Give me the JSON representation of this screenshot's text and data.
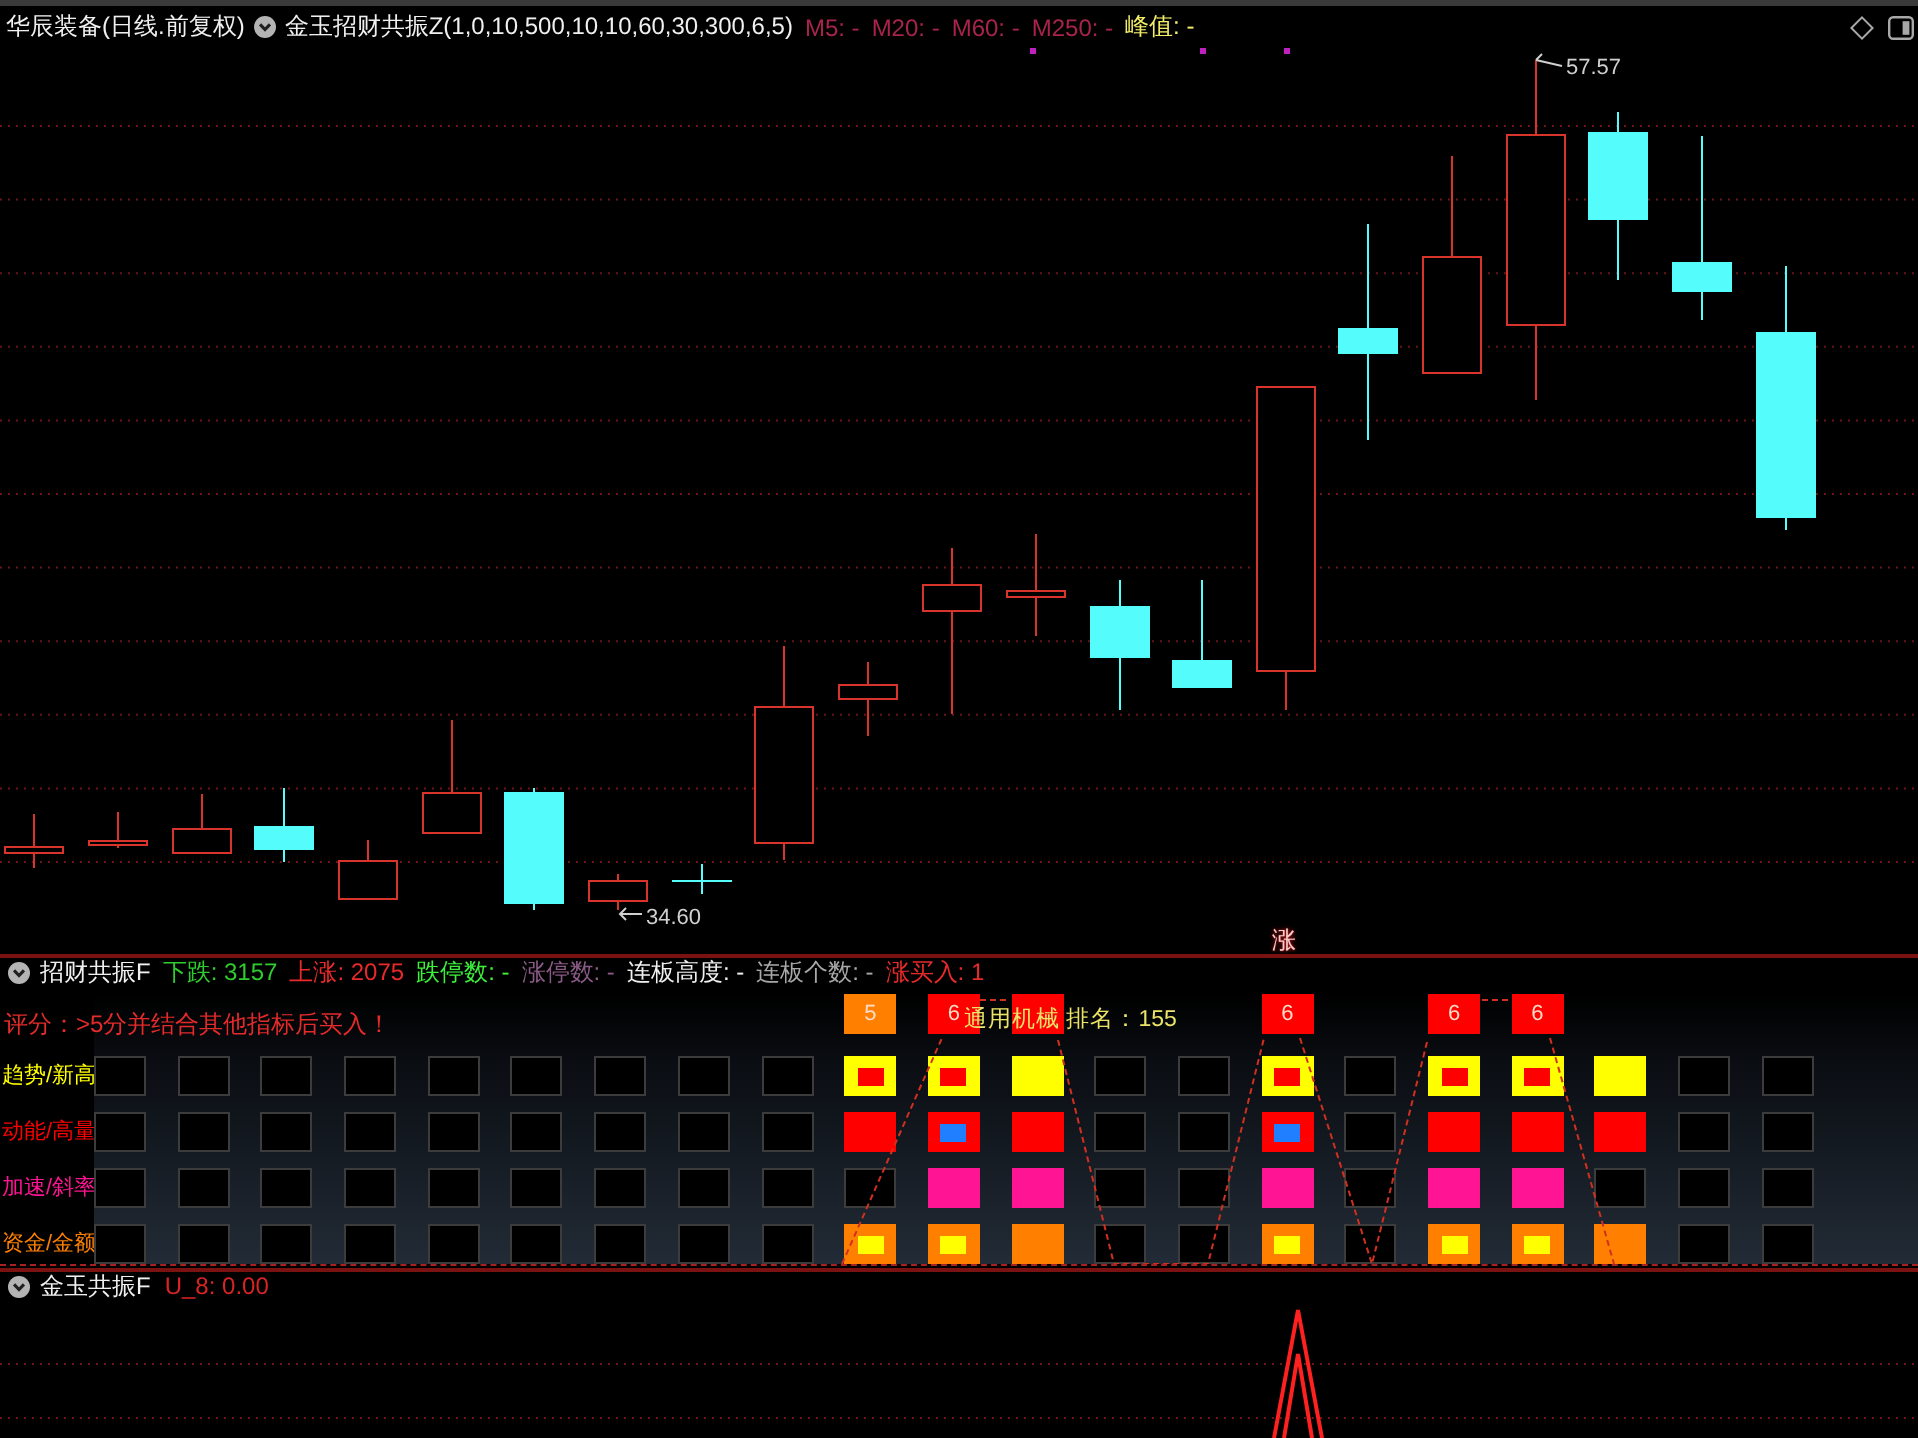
{
  "header": {
    "stock_title": "华辰装备(日线.前复权)",
    "indicator_title": "金玉招财共振Z(1,0,10,500,10,10,60,30,300,6,5)",
    "averages": [
      "M5: -",
      "M20: -",
      "M60: -",
      "M250: -"
    ],
    "peak": "峰值: -"
  },
  "price_chart": {
    "high_label": "57.57",
    "low_label": "34.60",
    "signal_label": "涨"
  },
  "signal_panel": {
    "title": "招财共振F",
    "stats": [
      {
        "text": "下跌: 3157",
        "color": "#2ecc2e"
      },
      {
        "text": "上涨: 2075",
        "color": "#e82a2a"
      },
      {
        "text": "跌停数: -",
        "color": "#3cf03c"
      },
      {
        "text": "涨停数: -",
        "color": "#8a5a86"
      },
      {
        "text": "连板高度: -",
        "color": "#f0f0f0"
      },
      {
        "text": "连板个数: -",
        "color": "#a8a8a8"
      },
      {
        "text": "涨买入: 1",
        "color": "#e82a2a"
      }
    ],
    "hint": "评分：>5分并结合其他指标后买入！",
    "industry_rank": "通用机械 排名：155",
    "scores": [
      {
        "kind": "none"
      },
      {
        "kind": "none"
      },
      {
        "kind": "none"
      },
      {
        "kind": "none"
      },
      {
        "kind": "none"
      },
      {
        "kind": "none"
      },
      {
        "kind": "none"
      },
      {
        "kind": "none"
      },
      {
        "kind": "none"
      },
      {
        "kind": "box",
        "value": "5",
        "color": "#ff8000"
      },
      {
        "kind": "box",
        "value": "6",
        "color": "#ff0000"
      },
      {
        "kind": "box",
        "color": "#ff0000"
      },
      {
        "kind": "none"
      },
      {
        "kind": "none"
      },
      {
        "kind": "box",
        "value": "6",
        "color": "#ff0000"
      },
      {
        "kind": "none"
      },
      {
        "kind": "box",
        "value": "6",
        "color": "#ff0000"
      },
      {
        "kind": "box",
        "value": "6",
        "color": "#ff0000"
      },
      {
        "kind": "none"
      },
      {
        "kind": "none"
      },
      {
        "kind": "none"
      }
    ],
    "rows": [
      {
        "label": "趋势/新高",
        "color": "#ffff00",
        "kind": "trend",
        "cells": [
          {
            "on": false,
            "marked": false
          },
          {
            "on": false,
            "marked": false
          },
          {
            "on": false,
            "marked": false
          },
          {
            "on": false,
            "marked": false
          },
          {
            "on": false,
            "marked": false
          },
          {
            "on": false,
            "marked": false
          },
          {
            "on": false,
            "marked": false
          },
          {
            "on": false,
            "marked": false
          },
          {
            "on": false,
            "marked": false
          },
          {
            "on": true,
            "marked": true
          },
          {
            "on": true,
            "marked": true
          },
          {
            "on": true,
            "marked": false
          },
          {
            "on": false,
            "marked": false
          },
          {
            "on": false,
            "marked": false
          },
          {
            "on": true,
            "marked": true
          },
          {
            "on": false,
            "marked": false
          },
          {
            "on": true,
            "marked": true
          },
          {
            "on": true,
            "marked": true
          },
          {
            "on": true,
            "marked": false
          },
          {
            "on": false,
            "marked": false
          },
          {
            "on": false,
            "marked": false
          }
        ]
      },
      {
        "label": "动能/高量",
        "color": "#ff0000",
        "kind": "momentum",
        "cells": [
          {
            "on": false,
            "marked": false
          },
          {
            "on": false,
            "marked": false
          },
          {
            "on": false,
            "marked": false
          },
          {
            "on": false,
            "marked": false
          },
          {
            "on": false,
            "marked": false
          },
          {
            "on": false,
            "marked": false
          },
          {
            "on": false,
            "marked": false
          },
          {
            "on": false,
            "marked": false
          },
          {
            "on": false,
            "marked": false
          },
          {
            "on": true,
            "marked": false
          },
          {
            "on": true,
            "marked": true
          },
          {
            "on": true,
            "marked": false
          },
          {
            "on": false,
            "marked": false
          },
          {
            "on": false,
            "marked": false
          },
          {
            "on": true,
            "marked": true
          },
          {
            "on": false,
            "marked": false
          },
          {
            "on": true,
            "marked": false
          },
          {
            "on": true,
            "marked": false
          },
          {
            "on": true,
            "marked": false
          },
          {
            "on": false,
            "marked": false
          },
          {
            "on": false,
            "marked": false
          }
        ]
      },
      {
        "label": "加速/斜率",
        "color": "#ff1493",
        "cells": [
          {
            "on": false,
            "marked": false
          },
          {
            "on": false,
            "marked": false
          },
          {
            "on": false,
            "marked": false
          },
          {
            "on": false,
            "marked": false
          },
          {
            "on": false,
            "marked": false
          },
          {
            "on": false,
            "marked": false
          },
          {
            "on": false,
            "marked": false
          },
          {
            "on": false,
            "marked": false
          },
          {
            "on": false,
            "marked": false
          },
          {
            "on": false,
            "marked": false
          },
          {
            "on": true,
            "marked": false
          },
          {
            "on": true,
            "marked": false
          },
          {
            "on": false,
            "marked": false
          },
          {
            "on": false,
            "marked": false
          },
          {
            "on": true,
            "marked": false
          },
          {
            "on": false,
            "marked": false
          },
          {
            "on": true,
            "marked": false
          },
          {
            "on": true,
            "marked": false
          },
          {
            "on": false,
            "marked": false
          },
          {
            "on": false,
            "marked": false
          },
          {
            "on": false,
            "marked": false
          }
        ]
      },
      {
        "label": "资金/金额",
        "color": "#ff8000",
        "kind": "funds",
        "cells": [
          {
            "on": false,
            "marked": false
          },
          {
            "on": false,
            "marked": false
          },
          {
            "on": false,
            "marked": false
          },
          {
            "on": false,
            "marked": false
          },
          {
            "on": false,
            "marked": false
          },
          {
            "on": false,
            "marked": false
          },
          {
            "on": false,
            "marked": false
          },
          {
            "on": false,
            "marked": false
          },
          {
            "on": false,
            "marked": false
          },
          {
            "on": true,
            "marked": true
          },
          {
            "on": true,
            "marked": true
          },
          {
            "on": true,
            "marked": false
          },
          {
            "on": false,
            "marked": false
          },
          {
            "on": false,
            "marked": false
          },
          {
            "on": true,
            "marked": true
          },
          {
            "on": false,
            "marked": false
          },
          {
            "on": true,
            "marked": true
          },
          {
            "on": true,
            "marked": true
          },
          {
            "on": true,
            "marked": false
          },
          {
            "on": false,
            "marked": false
          },
          {
            "on": false,
            "marked": false
          }
        ]
      }
    ]
  },
  "indicator_panel": {
    "title": "金玉共振F",
    "reading": "U_8: 0.00"
  }
}
